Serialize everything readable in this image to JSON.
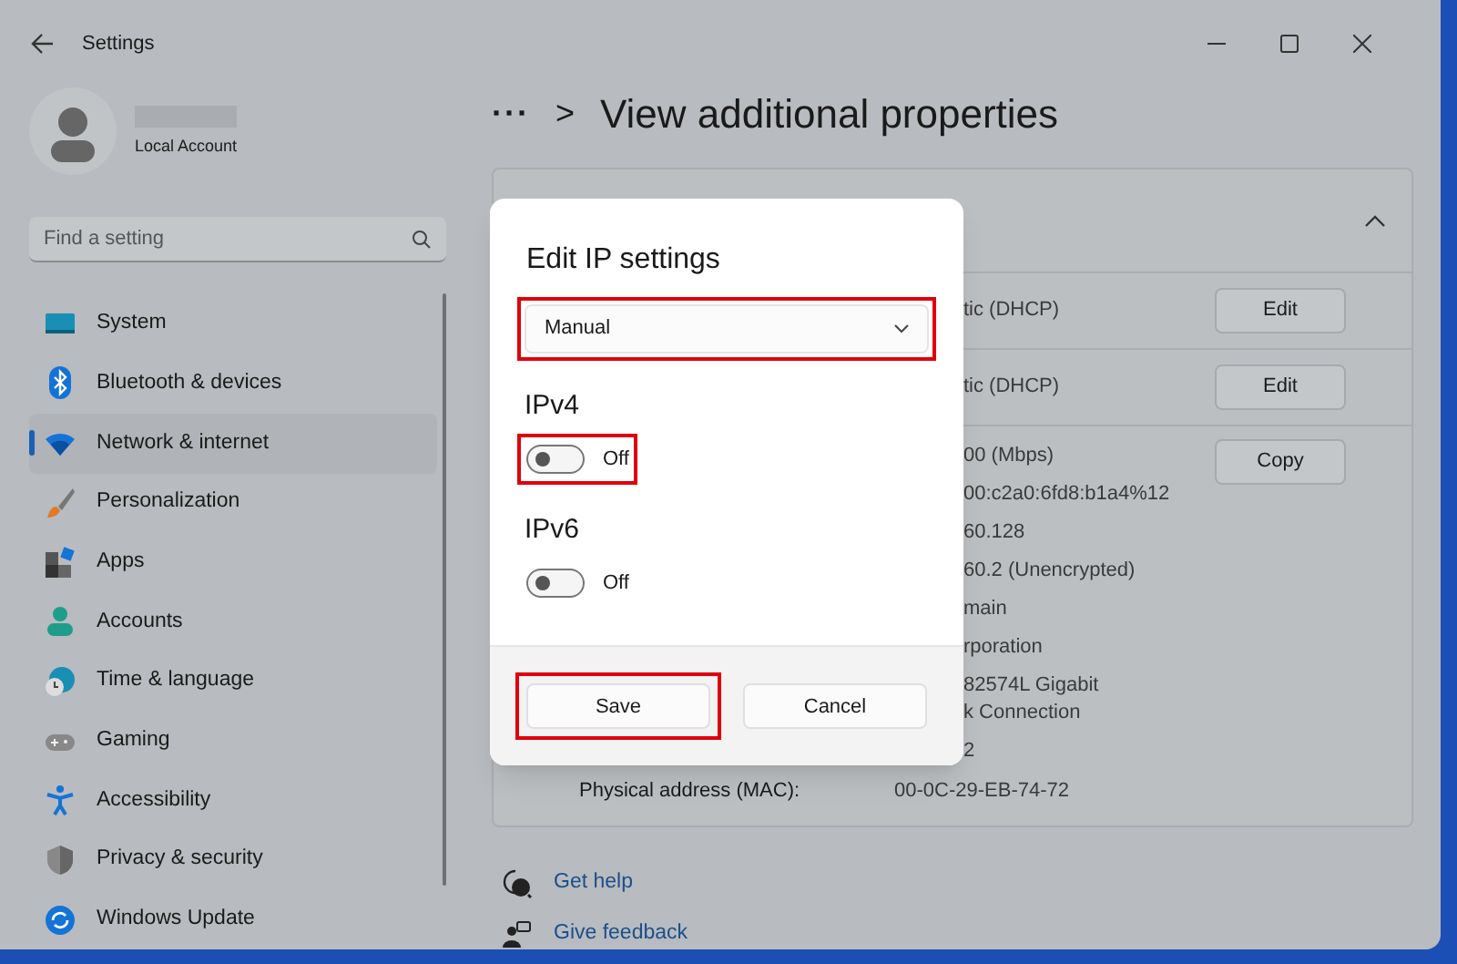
{
  "window": {
    "title": "Settings"
  },
  "account": {
    "type": "Local Account"
  },
  "search": {
    "placeholder": "Find a setting"
  },
  "nav": [
    {
      "label": "System",
      "kind": "system",
      "selected": false
    },
    {
      "label": "Bluetooth & devices",
      "kind": "bluetooth",
      "selected": false
    },
    {
      "label": "Network & internet",
      "kind": "network",
      "selected": true
    },
    {
      "label": "Personalization",
      "kind": "brush",
      "selected": false
    },
    {
      "label": "Apps",
      "kind": "apps",
      "selected": false
    },
    {
      "label": "Accounts",
      "kind": "accounts",
      "selected": false
    },
    {
      "label": "Time & language",
      "kind": "time",
      "selected": false
    },
    {
      "label": "Gaming",
      "kind": "gaming",
      "selected": false
    },
    {
      "label": "Accessibility",
      "kind": "accessibility",
      "selected": false
    },
    {
      "label": "Privacy & security",
      "kind": "privacy",
      "selected": false
    },
    {
      "label": "Windows Update",
      "kind": "update",
      "selected": false
    }
  ],
  "breadcrumb": {
    "more": "···",
    "separator": ">",
    "title": "View additional properties"
  },
  "card": {
    "expanded": true,
    "edit_rows": [
      {
        "value": "tic (DHCP)",
        "button": "Edit"
      },
      {
        "value": "tic (DHCP)",
        "button": "Edit"
      }
    ],
    "details": [
      {
        "value": "00 (Mbps)"
      },
      {
        "value": "00:c2a0:6fd8:b1a4%12"
      },
      {
        "value": "60.128"
      },
      {
        "value": "60.2 (Unencrypted)"
      },
      {
        "value": "main"
      },
      {
        "value": "rporation"
      },
      {
        "value": "82574L Gigabit\nk Connection"
      },
      {
        "value": "2"
      }
    ],
    "copy_button": "Copy",
    "mac": {
      "label": "Physical address (MAC):",
      "value": "00-0C-29-EB-74-72"
    }
  },
  "dialog": {
    "title": "Edit IP settings",
    "dropdown": {
      "value": "Manual",
      "highlighted": true
    },
    "sections": [
      {
        "heading": "IPv4",
        "on": false,
        "state_label": "Off",
        "highlighted": true
      },
      {
        "heading": "IPv6",
        "on": false,
        "state_label": "Off",
        "highlighted": false
      }
    ],
    "buttons": [
      {
        "label": "Save",
        "highlighted": true
      },
      {
        "label": "Cancel",
        "highlighted": false
      }
    ]
  },
  "links": [
    {
      "label": "Get help",
      "kind": "help"
    },
    {
      "label": "Give feedback",
      "kind": "feedback"
    }
  ]
}
